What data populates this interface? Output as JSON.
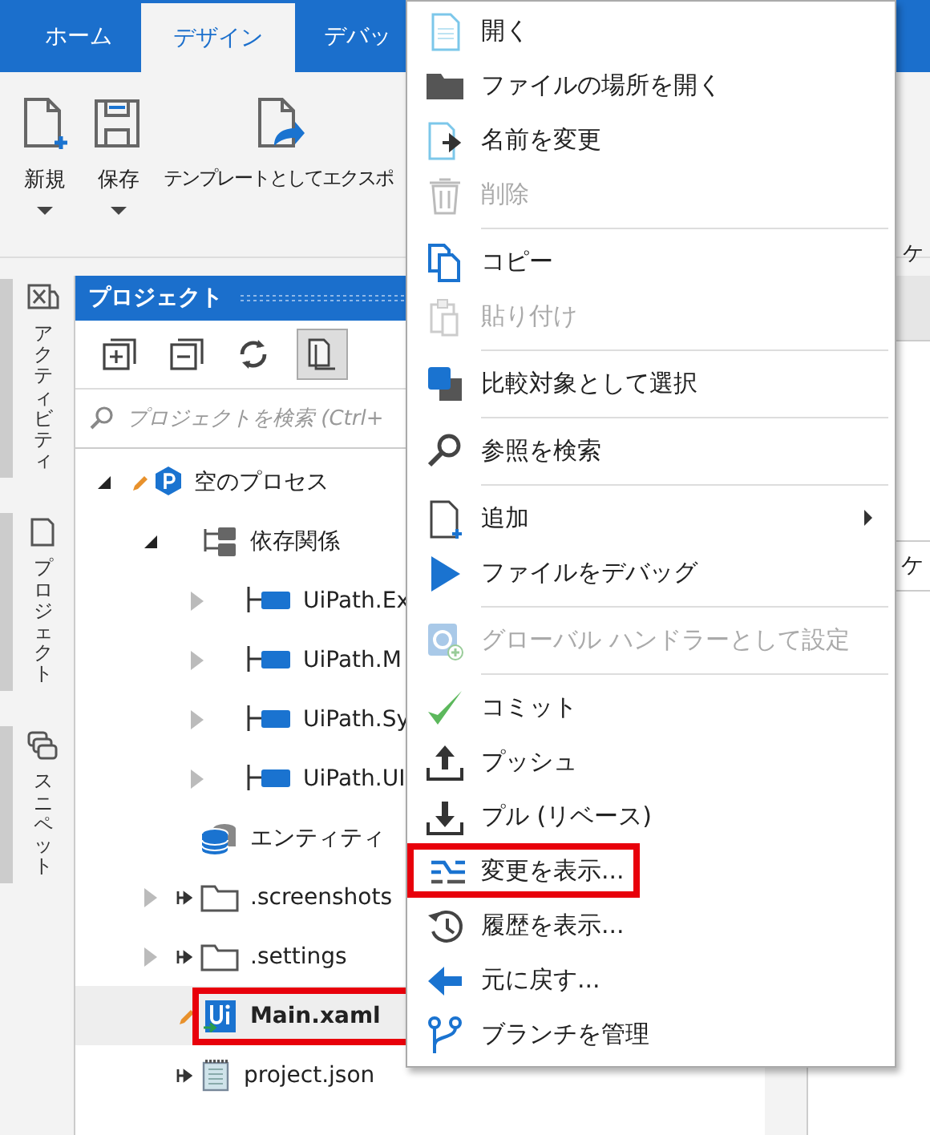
{
  "ribbon_tabs": [
    {
      "label": "ホーム",
      "selected": false
    },
    {
      "label": "デザイン",
      "selected": true
    },
    {
      "label": "デバッ",
      "selected": false
    }
  ],
  "ribbon_buttons": [
    {
      "kind": "new",
      "label": "新規",
      "dropdown": true
    },
    {
      "kind": "save",
      "label": "保存",
      "dropdown": true
    },
    {
      "kind": "export",
      "label": "テンプレートとしてエクスポ",
      "dropdown": false
    }
  ],
  "ribbon_right_label": "ケ",
  "side_tabs": [
    {
      "kind": "activities",
      "label": "アクティビティ"
    },
    {
      "kind": "project",
      "label": "プロジェクト"
    },
    {
      "kind": "snippets",
      "label": "スニペット"
    }
  ],
  "project_panel": {
    "title": "プロジェクト",
    "toolbar": [
      {
        "kind": "expand",
        "pressed": false
      },
      {
        "kind": "collapse",
        "pressed": false
      },
      {
        "kind": "refresh",
        "pressed": false
      },
      {
        "kind": "files",
        "pressed": true
      }
    ],
    "search": {
      "placeholder": "プロジェクトを検索 (Ctrl+"
    },
    "tree": [
      {
        "kind": "project",
        "label": "空のプロセス",
        "expanded": true,
        "modified": true,
        "children": [
          {
            "kind": "dependencies",
            "label": "依存関係",
            "expanded": true,
            "children": [
              {
                "kind": "package",
                "label": "UiPath.Ex",
                "expanded": false
              },
              {
                "kind": "package",
                "label": "UiPath.M",
                "expanded": false
              },
              {
                "kind": "package",
                "label": "UiPath.Sy",
                "expanded": false
              },
              {
                "kind": "package",
                "label": "UiPath.UI",
                "expanded": false
              }
            ]
          },
          {
            "kind": "entities",
            "label": "エンティティ"
          },
          {
            "kind": "folder",
            "label": ".screenshots",
            "expanded": false
          },
          {
            "kind": "folder",
            "label": ".settings",
            "expanded": false
          },
          {
            "kind": "workflow",
            "label": "Main.xaml",
            "modified": true,
            "selected": true,
            "highlighted": true
          },
          {
            "kind": "json",
            "label": "project.json"
          }
        ]
      }
    ]
  },
  "right_pane_label": "ケ",
  "context_menu": [
    {
      "kind": "open",
      "label": "開く",
      "disabled": false
    },
    {
      "kind": "folder",
      "label": "ファイルの場所を開く",
      "disabled": false
    },
    {
      "kind": "rename",
      "label": "名前を変更",
      "disabled": false
    },
    {
      "kind": "delete",
      "label": "削除",
      "disabled": true
    },
    {
      "kind": "separator"
    },
    {
      "kind": "copy",
      "label": "コピー",
      "disabled": false
    },
    {
      "kind": "paste",
      "label": "貼り付け",
      "disabled": true
    },
    {
      "kind": "separator"
    },
    {
      "kind": "compare",
      "label": "比較対象として選択",
      "disabled": false
    },
    {
      "kind": "separator"
    },
    {
      "kind": "find",
      "label": "参照を検索",
      "disabled": false
    },
    {
      "kind": "separator"
    },
    {
      "kind": "add",
      "label": "追加",
      "disabled": false,
      "submenu": true
    },
    {
      "kind": "debug",
      "label": "ファイルをデバッグ",
      "disabled": false
    },
    {
      "kind": "separator"
    },
    {
      "kind": "handler",
      "label": "グローバル ハンドラーとして設定",
      "disabled": true
    },
    {
      "kind": "separator"
    },
    {
      "kind": "commit",
      "label": "コミット",
      "disabled": false
    },
    {
      "kind": "push",
      "label": "プッシュ",
      "disabled": false
    },
    {
      "kind": "pull",
      "label": "プル (リベース)",
      "disabled": false
    },
    {
      "kind": "diff",
      "label": "変更を表示...",
      "disabled": false,
      "highlighted": true
    },
    {
      "kind": "history",
      "label": "履歴を表示...",
      "disabled": false
    },
    {
      "kind": "undo",
      "label": "元に戻す...",
      "disabled": false
    },
    {
      "kind": "branch",
      "label": "ブランチを管理",
      "disabled": false
    }
  ]
}
